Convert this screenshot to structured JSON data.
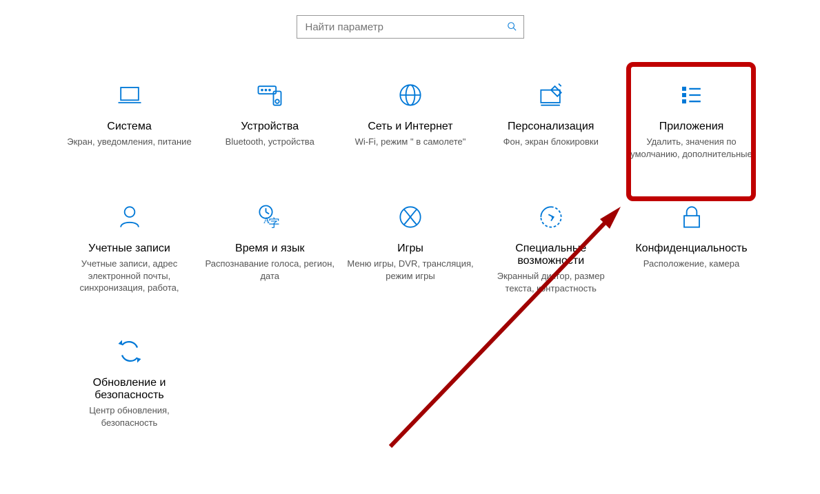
{
  "search": {
    "placeholder": "Найти параметр"
  },
  "accent": "#0078d7",
  "tiles": [
    {
      "id": "system",
      "title": "Система",
      "desc": "Экран, уведомления, питание"
    },
    {
      "id": "devices",
      "title": "Устройства",
      "desc": "Bluetooth, устройства"
    },
    {
      "id": "network",
      "title": "Сеть и Интернет",
      "desc": "Wi-Fi, режим \" в самолете\""
    },
    {
      "id": "personalization",
      "title": "Персонализация",
      "desc": "Фон, экран блокировки"
    },
    {
      "id": "apps",
      "title": "Приложения",
      "desc": "Удалить, значения по умолчанию, дополнительные"
    },
    {
      "id": "accounts",
      "title": "Учетные записи",
      "desc": "Учетные записи, адрес электронной почты, синхронизация, работа,"
    },
    {
      "id": "time",
      "title": "Время и язык",
      "desc": "Распознавание голоса, регион, дата"
    },
    {
      "id": "gaming",
      "title": "Игры",
      "desc": "Меню игры, DVR, трансляция, режим игры"
    },
    {
      "id": "ease",
      "title": "Специальные возможности",
      "desc": "Экранный диктор, размер текста, контрастность"
    },
    {
      "id": "privacy",
      "title": "Конфиденциальность",
      "desc": "Расположение, камера"
    },
    {
      "id": "update",
      "title": "Обновление и безопасность",
      "desc": "Центр обновления, безопасность"
    }
  ],
  "highlight_index": 4
}
